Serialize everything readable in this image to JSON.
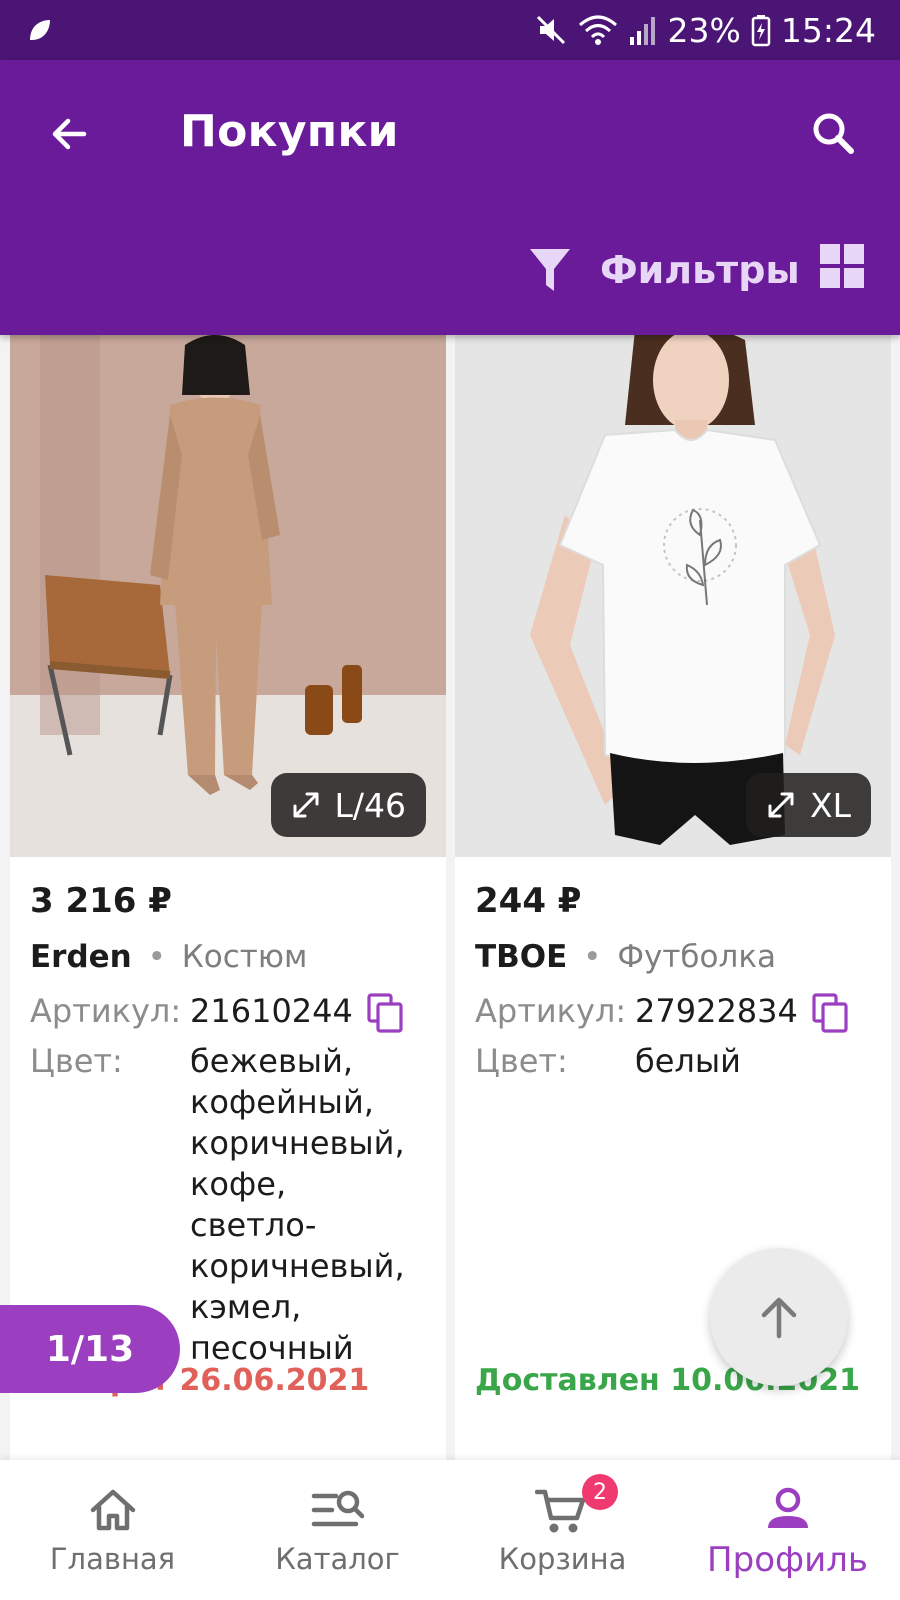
{
  "status_bar": {
    "battery": "23%",
    "time": "15:24"
  },
  "header": {
    "title": "Покупки",
    "filters_label": "Фильтры"
  },
  "products": [
    {
      "price": "3 216 ₽",
      "brand": "Erden",
      "separator": "•",
      "kind": "Костюм",
      "size": "L/46",
      "article_label": "Артикул:",
      "article": "21610244",
      "color_label": "Цвет:",
      "color": "бежевый, кофейный, коричневый, кофе, светло-коричневый, кэмел, песочный",
      "color_lines": [
        "бежевый,",
        "кофейный,",
        "коричневый,",
        "кофе,",
        "светло-",
        "коричневый,",
        "кэмел,",
        "песочный"
      ],
      "status": "Возврат 26.06.2021",
      "status_color": "#e0605a"
    },
    {
      "price": "244 ₽",
      "brand": "TBOE",
      "separator": "•",
      "kind": "Футболка",
      "size": "XL",
      "article_label": "Артикул:",
      "article": "27922834",
      "color_label": "Цвет:",
      "color": "белый",
      "status": "Доставлен 10.06.2021",
      "status_color": "#3aa64a"
    }
  ],
  "pagination": {
    "counter": "1/13"
  },
  "bottom_nav": {
    "items": [
      {
        "label": "Главная",
        "icon": "home-icon"
      },
      {
        "label": "Каталог",
        "icon": "catalog-icon"
      },
      {
        "label": "Корзина",
        "icon": "cart-icon",
        "badge": "2"
      },
      {
        "label": "Профиль",
        "icon": "profile-icon",
        "active": true
      }
    ]
  },
  "colors": {
    "status_bar": "#4a1574",
    "app_bar": "#6a1b9a",
    "accent": "#9b3fc0",
    "badge": "#f0396e"
  }
}
